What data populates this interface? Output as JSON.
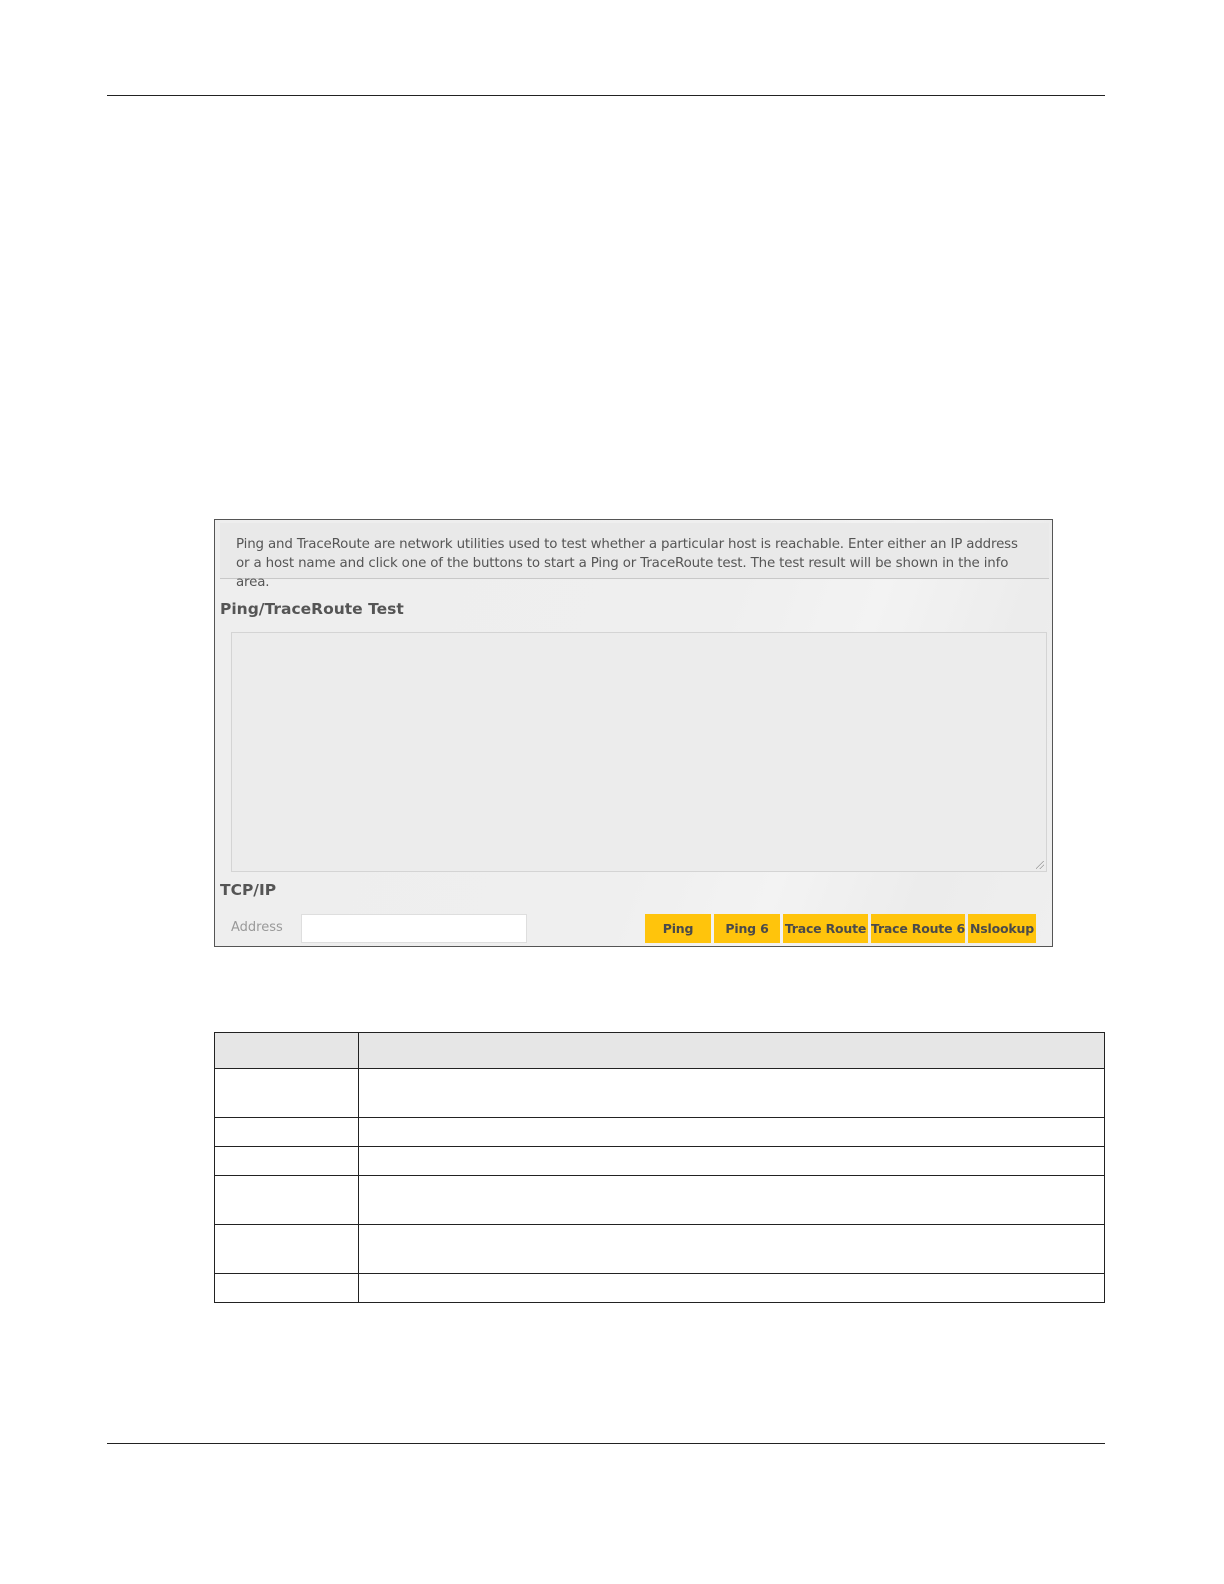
{
  "page": {
    "header_text": "",
    "footer_text": ""
  },
  "panel": {
    "info_text": "Ping and TraceRoute are network utilities used to test whether a particular host is reachable. Enter either an IP address or a host name and click one of the buttons to start a Ping or TraceRoute test. The test result will be shown in the info area.",
    "test_title": "Ping/TraceRoute Test",
    "result_text": "",
    "tcpip_title": "TCP/IP",
    "address_label": "Address",
    "address_value": "",
    "buttons": {
      "ping": "Ping",
      "ping6": "Ping 6",
      "trace_route": "Trace Route",
      "trace_route6": "Trace Route 6",
      "nslookup": "Nslookup"
    },
    "button_color": "#ffc40c"
  },
  "table": {
    "headers": [
      "",
      ""
    ],
    "rows": [
      [
        "",
        ""
      ],
      [
        "",
        ""
      ],
      [
        "",
        ""
      ],
      [
        "",
        ""
      ],
      [
        "",
        ""
      ],
      [
        "",
        ""
      ]
    ]
  }
}
